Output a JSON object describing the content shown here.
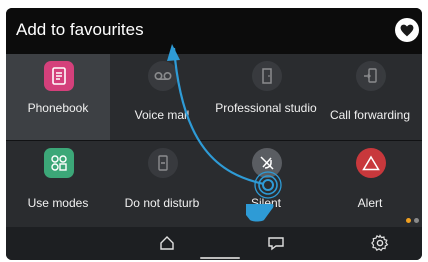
{
  "header": {
    "title": "Add to favourites",
    "heart_icon": "heart-icon"
  },
  "apps": [
    {
      "label": "Phonebook",
      "icon": "phonebook-icon",
      "color": "#d4407b"
    },
    {
      "label": "Voice mail",
      "icon": "voicemail-icon",
      "color": "#4a4d52"
    },
    {
      "label": "Professional studio",
      "icon": "door-icon",
      "color": "#4a4d52"
    },
    {
      "label": "Call forwarding",
      "icon": "call-forward-icon",
      "color": "#4a4d52"
    },
    {
      "label": "Use modes",
      "icon": "use-modes-icon",
      "color": "#3ca778"
    },
    {
      "label": "Do not disturb",
      "icon": "do-not-disturb-icon",
      "color": "#4a4d52"
    },
    {
      "label": "Silent",
      "icon": "silent-icon",
      "color": "#4a4d52"
    },
    {
      "label": "Alert",
      "icon": "alert-icon",
      "color": "#c8383c"
    }
  ],
  "dock": {
    "home_icon": "home-icon",
    "chat_icon": "chat-icon",
    "settings_icon": "settings-icon"
  },
  "colors": {
    "accent": "#2e9bd6",
    "page_dot_active": "#f0a020",
    "page_dot_inactive": "#6a6a6a"
  }
}
